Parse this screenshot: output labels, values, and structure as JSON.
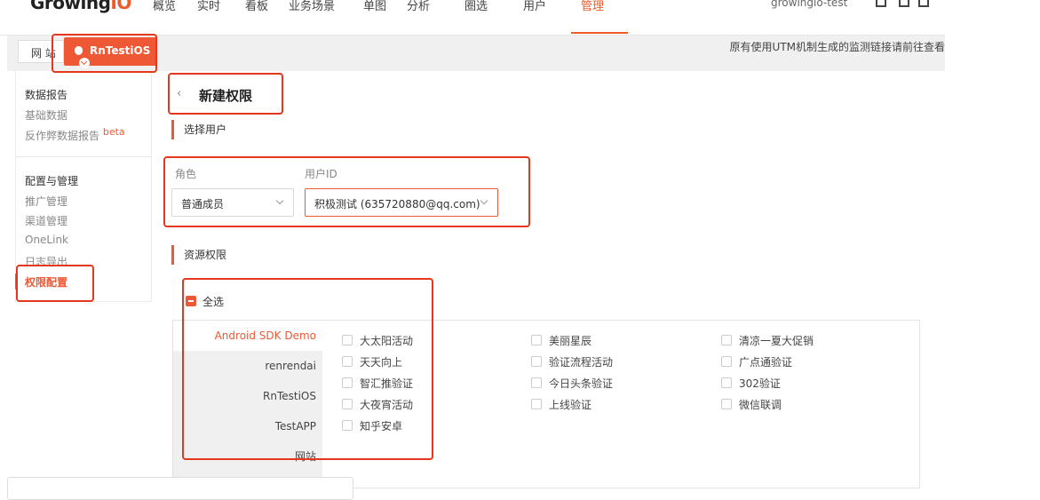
{
  "topnav": {
    "logo": "Growing",
    "logo_dot": "IO",
    "items": [
      "概览",
      "实时",
      "看板",
      "业务场景",
      "单图",
      "分析",
      "圈选",
      "用户",
      "管理"
    ],
    "active_index": 8,
    "user": "growingio-test",
    "icons": [
      "hamburger-icon",
      "document-icon",
      "mail-icon"
    ]
  },
  "subbar": {
    "site_button": "网 站",
    "app_button": "RnTestiOS",
    "notice": "原有使用UTM机制生成的监测链接请前往查看"
  },
  "sidebar": {
    "section1_title": "数据报告",
    "section1_items": [
      "基础数据",
      "反作弊数据报告"
    ],
    "beta_label": "beta",
    "section2_title": "配置与管理",
    "section2_items": [
      "推广管理",
      "渠道管理",
      "OneLink",
      "日志导出",
      "权限配置"
    ],
    "active_item": "权限配置"
  },
  "main": {
    "title": "新建权限",
    "section_user": "选择用户",
    "role_label": "角色",
    "role_value": "普通成员",
    "userid_label": "用户ID",
    "userid_value": "积极测试 (635720880@qq.com)",
    "section_resource": "资源权限",
    "select_all": "全选",
    "projects": [
      "Android SDK Demo",
      "renrendai",
      "RnTestiOS",
      "TestAPP",
      "网站"
    ],
    "active_project": "Android SDK Demo",
    "activities": {
      "col1": [
        "大太阳活动",
        "天天向上",
        "智汇推验证",
        "大夜宵活动",
        "知乎安卓"
      ],
      "col2": [
        "美丽星辰",
        "验证流程活动",
        "今日头条验证",
        "上线验证"
      ],
      "col3": [
        "清凉一夏大促销",
        "广点通验证",
        "302验证",
        "微信联调"
      ]
    }
  },
  "colors": {
    "accent": "#ef5834",
    "annotation": "#e5371c"
  }
}
